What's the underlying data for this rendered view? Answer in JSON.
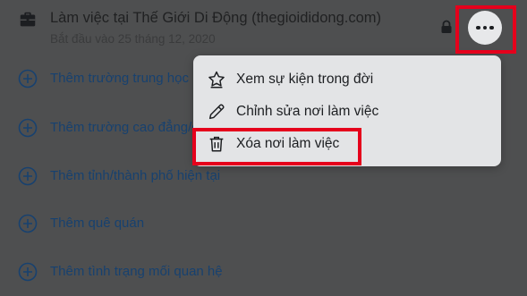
{
  "work": {
    "title": "Làm việc tại Thế Giới Di Động (thegioididong.com)",
    "subtitle": "Bắt đầu vào 25 tháng 12, 2020",
    "icon": "briefcase-icon",
    "privacy_icon": "lock-icon",
    "more_icon": "more-horizontal-icon"
  },
  "add_items": [
    {
      "label": "Thêm trường trung học",
      "icon": "plus-circle-icon"
    },
    {
      "label": "Thêm trường cao đẳng/đại học",
      "icon": "plus-circle-icon"
    },
    {
      "label": "Thêm tỉnh/thành phố hiện tại",
      "icon": "plus-circle-icon"
    },
    {
      "label": "Thêm quê quán",
      "icon": "plus-circle-icon"
    },
    {
      "label": "Thêm tình trạng mối quan hệ",
      "icon": "plus-circle-icon"
    }
  ],
  "menu": {
    "items": [
      {
        "label": "Xem sự kiện trong đời",
        "icon": "star-icon"
      },
      {
        "label": "Chỉnh sửa nơi làm việc",
        "icon": "pencil-icon"
      },
      {
        "label": "Xóa nơi làm việc",
        "icon": "trash-icon"
      }
    ]
  },
  "colors": {
    "overlay_background": "#4e4f50",
    "link_blue": "#17416f",
    "menu_background": "#e3e4e6",
    "highlight_red": "#e5001c"
  }
}
